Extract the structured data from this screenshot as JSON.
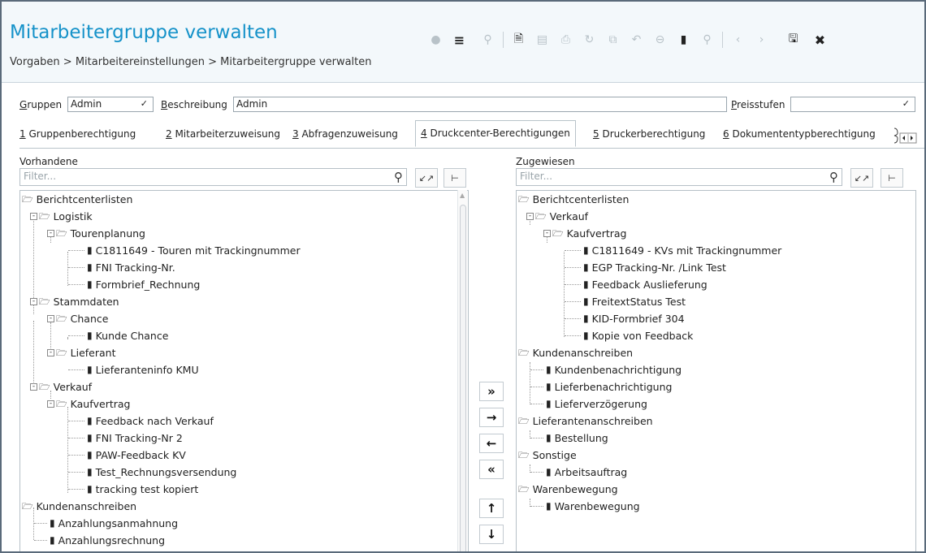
{
  "header": {
    "title": "Mitarbeitergruppe verwalten",
    "breadcrumb": "Vorgaben > Mitarbeitereinstellungen > Mitarbeitergruppe verwalten"
  },
  "toolbar": {
    "icons": [
      "chat-icon",
      "menu-list-icon",
      "location-pin-icon",
      "new-document-icon",
      "folder-icon",
      "print-icon",
      "refresh-icon",
      "copy-icon",
      "undo-icon",
      "minus-circle-icon",
      "trash-icon",
      "search-icon",
      "prev-icon",
      "next-icon",
      "save-icon",
      "close-icon"
    ]
  },
  "fields": {
    "gruppen_label_u": "G",
    "gruppen_label_rest": "ruppen",
    "gruppen_value": "Admin",
    "beschreibung_label_u": "B",
    "beschreibung_label_rest": "eschreibung",
    "beschreibung_value": "Admin",
    "preisstufen_label_u": "P",
    "preisstufen_label_rest": "reisstufen",
    "preisstufen_value": ""
  },
  "tabs": [
    {
      "num": "1",
      "label": " Gruppenberechtigung"
    },
    {
      "num": "2",
      "label": " Mitarbeiterzuweisung"
    },
    {
      "num": "3",
      "label": " Abfragenzuweisung"
    },
    {
      "num": "4",
      "label": " Druckcenter-Berechtigungen"
    },
    {
      "num": "5",
      "label": " Druckerberechtigung"
    },
    {
      "num": "6",
      "label": " Dokumententypberechtigung"
    }
  ],
  "left": {
    "label": "Vorhandene",
    "filter_placeholder": "Filter...",
    "nodes": [
      "Berichtcenterlisten",
      "Logistik",
      "Tourenplanung",
      "C1811649 - Touren mit Trackingnummer",
      "FNI Tracking-Nr.",
      "Formbrief_Rechnung",
      "Stammdaten",
      "Chance",
      "Kunde Chance",
      "Lieferant",
      "Lieferanteninfo KMU",
      "Verkauf",
      "Kaufvertrag",
      "Feedback nach Verkauf",
      "FNI Tracking-Nr 2",
      "PAW-Feedback KV",
      "Test_Rechnungsversendung",
      "tracking test kopiert",
      "Kundenanschreiben",
      "Anzahlungsanmahnung",
      "Anzahlungsrechnung"
    ]
  },
  "right": {
    "label": "Zugewiesen",
    "filter_placeholder": "Filter...",
    "nodes": [
      "Berichtcenterlisten",
      "Verkauf",
      "Kaufvertrag",
      "C1811649 - KVs mit Trackingnummer",
      "EGP Tracking-Nr. /Link Test",
      "Feedback Auslieferung",
      "FreitextStatus Test",
      "KID-Formbrief 304",
      "Kopie von Feedback",
      "Kundenanschreiben",
      "Kundenbenachrichtigung",
      "Lieferbenachrichtigung",
      "Lieferverzögerung",
      "Lieferantenanschreiben",
      "Bestellung",
      "Sonstige",
      "Arbeitsauftrag",
      "Warenbewegung",
      "Warenbewegung"
    ]
  },
  "move_buttons": {
    "all_right": "»",
    "right": "→",
    "left": "←",
    "all_left": "«",
    "up": "↑",
    "down": "↓"
  }
}
